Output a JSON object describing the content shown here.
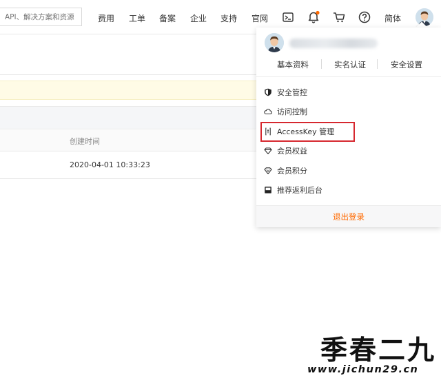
{
  "topbar": {
    "search_placeholder": "API、解决方案和资源",
    "nav": [
      "费用",
      "工单",
      "备案",
      "企业",
      "支持",
      "官网"
    ],
    "icons": [
      "terminal-icon",
      "bell-icon",
      "cart-icon",
      "help-icon"
    ],
    "notification_dot_color": "#ff6a00",
    "language": "简体"
  },
  "table": {
    "column_created": "创建时间",
    "created_value": "2020-04-01 10:33:23"
  },
  "dropdown": {
    "quick_links": [
      "基本资料",
      "实名认证",
      "安全设置"
    ],
    "menu": [
      {
        "label": "安全管控",
        "icon": "shield-icon"
      },
      {
        "label": "访问控制",
        "icon": "cloud-icon"
      },
      {
        "label": "AccessKey 管理",
        "icon": "key-icon",
        "highlighted": true
      },
      {
        "label": "会员权益",
        "icon": "diamond-icon"
      },
      {
        "label": "会员积分",
        "icon": "gem-icon"
      },
      {
        "label": "推荐返利后台",
        "icon": "gift-icon"
      }
    ],
    "logout": "退出登录",
    "highlight_color": "#d6282f",
    "logout_color": "#ff6a00"
  },
  "watermark": {
    "title": "季春二九",
    "url": "www.jichun29.cn"
  }
}
